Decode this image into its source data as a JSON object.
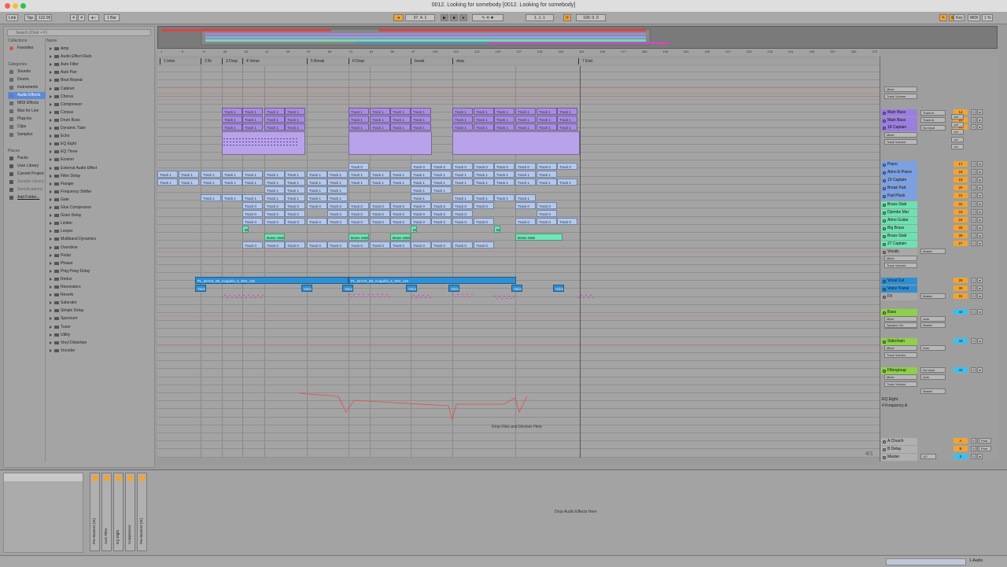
{
  "window": {
    "title": "0012. Looking for somebody  [0012. Looking for somebody]"
  },
  "transport": {
    "link": "Link",
    "tap": "Tap",
    "tempo": "122.00",
    "sig_num": "4",
    "sig_den": "4",
    "quantize": "1 Bar",
    "position": "37.  4.  1",
    "loop_start": "1.  1.  1",
    "loop_length": "190.  0.  0",
    "key": "Key",
    "midi": "MIDI",
    "cpu": "1 %",
    "colors": {
      "accent": "#f2a431",
      "play": "#2e2e2e"
    }
  },
  "browser": {
    "search_placeholder": "Search (Cmd + F)",
    "collections_label": "Collections",
    "favorites": "Favorites",
    "categories_label": "Categories",
    "categories": [
      "Sounds",
      "Drums",
      "Instruments",
      "Audio Effects",
      "MIDI Effects",
      "Max for Live",
      "Plug-ins",
      "Clips",
      "Samples"
    ],
    "selected_category": "Audio Effects",
    "places_label": "Places",
    "places": [
      "Packs",
      "User Library",
      "Current Project",
      "Sample Library",
      "StemAcademy",
      "Add Folder..."
    ],
    "name_header": "Name",
    "devices": [
      "Amp",
      "Audio Effect Rack",
      "Auto Filter",
      "Auto Pan",
      "Beat Repeat",
      "Cabinet",
      "Chorus",
      "Compressor",
      "Corpus",
      "Drum Buss",
      "Dynamic Tube",
      "Echo",
      "EQ Eight",
      "EQ Three",
      "Erosion",
      "External Audio Effect",
      "Filter Delay",
      "Flanger",
      "Frequency Shifter",
      "Gate",
      "Glue Compressor",
      "Grain Delay",
      "Limiter",
      "Looper",
      "Multiband Dynamics",
      "Overdrive",
      "Pedal",
      "Phaser",
      "Ping Pong Delay",
      "Redux",
      "Resonators",
      "Reverb",
      "Saturator",
      "Simple Delay",
      "Spectrum",
      "Tuner",
      "Utility",
      "Vinyl Distortion",
      "Vocoder"
    ]
  },
  "ruler": {
    "bars": [
      "1",
      "9",
      "17",
      "25",
      "33",
      "41",
      "49",
      "57",
      "65",
      "73",
      "81",
      "89",
      "97",
      "105",
      "113",
      "121",
      "129",
      "137",
      "145",
      "153",
      "161",
      "169",
      "177",
      "185",
      "193",
      "201",
      "209",
      "217",
      "225",
      "233",
      "241",
      "249",
      "257",
      "265",
      "273"
    ]
  },
  "locators": [
    {
      "label": "1 Intro"
    },
    {
      "label": "2 Br"
    },
    {
      "label": "3 Drop"
    },
    {
      "label": "4 Verse"
    },
    {
      "label": "5 Break"
    },
    {
      "label": "6 Drop"
    },
    {
      "label": "break"
    },
    {
      "label": "drop"
    },
    {
      "label": "7 End"
    }
  ],
  "clips": {
    "track1": "Track 1",
    "track0": "Track 0",
    "brass": "Brass Stab",
    "br": "Br",
    "vocal_a": "PL_DHVS_08_Acapella_5_Wet_118",
    "vocal_b": "PL_DHVS_08_Acapella_5_Wet_118",
    "vox": "Voice"
  },
  "arrangement": {
    "drop_hint": "Drop Files and Devices Here",
    "fraction": "4/1"
  },
  "mixer": {
    "tracks": [
      {
        "name": "Main Bass",
        "num": "14",
        "color": "#9c7ee0"
      },
      {
        "name": "Main Bass",
        "num": "15",
        "color": "#9c7ee0"
      },
      {
        "name": "18 Captain",
        "num": "16",
        "color": "#9c7ee0"
      },
      {
        "name": "Piano",
        "num": "17",
        "color": "#7aa0e6"
      },
      {
        "name": "Atmo E-Piano",
        "num": "18",
        "color": "#7aa0e6"
      },
      {
        "name": "19 Captain",
        "num": "19",
        "color": "#7aa0e6"
      },
      {
        "name": "Break Pad",
        "num": "20",
        "color": "#7aa0e6"
      },
      {
        "name": "Pad Pluck",
        "num": "21",
        "color": "#7aa0e6"
      },
      {
        "name": "Brass Stab",
        "num": "22",
        "color": "#6de2b0"
      },
      {
        "name": "Djembe Mar",
        "num": "23",
        "color": "#6de2b0"
      },
      {
        "name": "Atmo Guitar",
        "num": "24",
        "color": "#6de2b0"
      },
      {
        "name": "Big Brass",
        "num": "25",
        "color": "#6de2b0"
      },
      {
        "name": "Brass Stab",
        "num": "26",
        "color": "#6de2b0"
      },
      {
        "name": "27 Captain",
        "num": "27",
        "color": "#6de2b0"
      }
    ],
    "vocals": {
      "name": "Vocals",
      "master": "Master"
    },
    "vocal_tracks": [
      {
        "name": "Vocal Cut",
        "num": "29"
      },
      {
        "name": "Voice Transi",
        "num": "30"
      }
    ],
    "fx": {
      "name": "FX",
      "num": "31"
    },
    "bass": {
      "name": "Bass",
      "num": "42"
    },
    "sidechain": {
      "name": "Sidechain",
      "num": "43"
    },
    "filtergroup": {
      "name": "Filtergroup",
      "num": "44"
    },
    "eq": {
      "device": "EQ Eight",
      "param": "4 Frequency A"
    },
    "returns": [
      {
        "name": "A Church",
        "num": "A"
      },
      {
        "name": "B Delay",
        "num": "B"
      },
      {
        "name": "Master",
        "num": "0"
      }
    ],
    "labels": {
      "mixer": "Mixer",
      "track_volume": "Track Volume",
      "track_in": "Track In",
      "no_input": "No Input",
      "in": "In",
      "auto": "Auto",
      "off": "Off",
      "speaker_on": "Speaker On",
      "post": "Post",
      "half": "1/2",
      "inf": "-inf"
    }
  },
  "device_chain": {
    "devices": [
      "Pre-Master2 [St]",
      "Auto Filter",
      "EQ Eight",
      "Compressor",
      "Pre-Master2 [St]"
    ],
    "drop_hint": "Drop Audio Effects Here"
  },
  "status": {
    "right_label": "1-Audio"
  }
}
